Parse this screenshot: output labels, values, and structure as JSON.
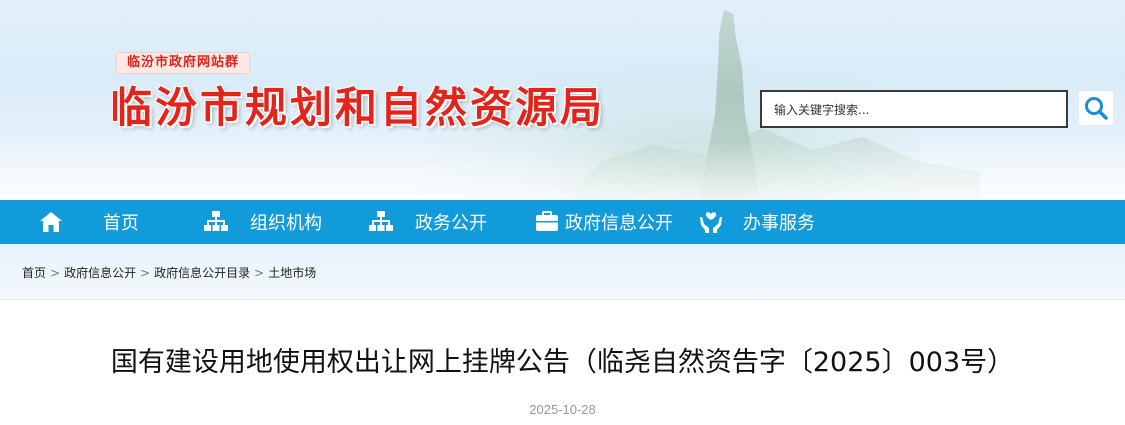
{
  "header": {
    "site_group": "临汾市政府网站群",
    "site_title": "临汾市规划和自然资源局"
  },
  "search": {
    "placeholder": "输入关键字搜索..."
  },
  "nav": {
    "items": [
      {
        "label": "首页",
        "icon": "home-icon"
      },
      {
        "label": "组织机构",
        "icon": "org-chart-icon"
      },
      {
        "label": "政务公开",
        "icon": "org-chart-icon"
      },
      {
        "label": "政府信息公开",
        "icon": "briefcase-icon"
      },
      {
        "label": "办事服务",
        "icon": "hands-service-icon"
      }
    ]
  },
  "breadcrumb": {
    "items": [
      "首页",
      "政府信息公开",
      "政府信息公开目录",
      "土地市场"
    ],
    "separator": ">"
  },
  "article": {
    "title": "国有建设用地使用权出让网上挂牌公告（临尧自然资告字〔2025〕003号）",
    "date": "2025-10-28"
  },
  "colors": {
    "nav_bg": "#129bdb",
    "title_red": "#e3241b",
    "search_icon": "#1a8fd6"
  }
}
